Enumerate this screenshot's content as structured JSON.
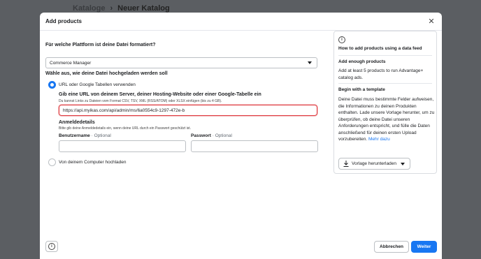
{
  "background": {
    "breadcrumb": [
      "Kataloge",
      "Neuer Katalog"
    ],
    "separator": "›"
  },
  "modal": {
    "title": "Add products",
    "close_icon": "close-icon"
  },
  "form": {
    "platform_question": "Für welche Plattform ist deine Datei formatiert?",
    "platform_select": {
      "value": "Commerce Manager"
    },
    "upload_question": "Wähle aus, wie deine Datei hochgeladen werden soll",
    "options": [
      {
        "label": "URL oder Google Tabellen verwenden",
        "selected": true
      },
      {
        "label": "Von deinem Computer hochladen",
        "selected": false
      }
    ],
    "url_section": {
      "title": "Gib eine URL von deinem Server, deiner Hosting-Website oder einer Google-Tabelle ein",
      "help": "Du kannst Links zu Dateien vom Format CSV, TSV, XML (RSS/ATOM) oder XLSX einfügen (bis zu 4 GB).",
      "value": "https://api.myikas.com/api/admin/ms/6a0554c9-1297-472e-b"
    },
    "credentials": {
      "title": "Anmeldedetails",
      "help": "Bitte gib deine Anmeldedetails ein, wenn deine URL durch ein Passwort geschützt ist.",
      "username_label": "Benutzername",
      "password_label": "Passwort",
      "optional": "· Optional"
    }
  },
  "side_panel": {
    "heading": "How to add products using a data feed",
    "section1_title": "Add enough products",
    "section1_text": "Add at least 5 products to run Advantage+ catalog ads.",
    "section2_title": "Begin with a template",
    "section2_text": "Deine Datei muss bestimmte Felder aufweisen, die Informationen zu deinen Produkten enthalten. Lade unsere Vorlage herunter, um zu überprüfen, ob deine Datei unseren Anforderungen entspricht, und fülle die Daten anschließend für deinen ersten Upload vorzubereiten.",
    "section2_link": "Mehr dazu",
    "template_button": "Vorlage herunterladen"
  },
  "footer": {
    "cancel": "Abbrechen",
    "next": "Weiter"
  },
  "colors": {
    "accent": "#1877f2",
    "error": "#e0393e"
  }
}
